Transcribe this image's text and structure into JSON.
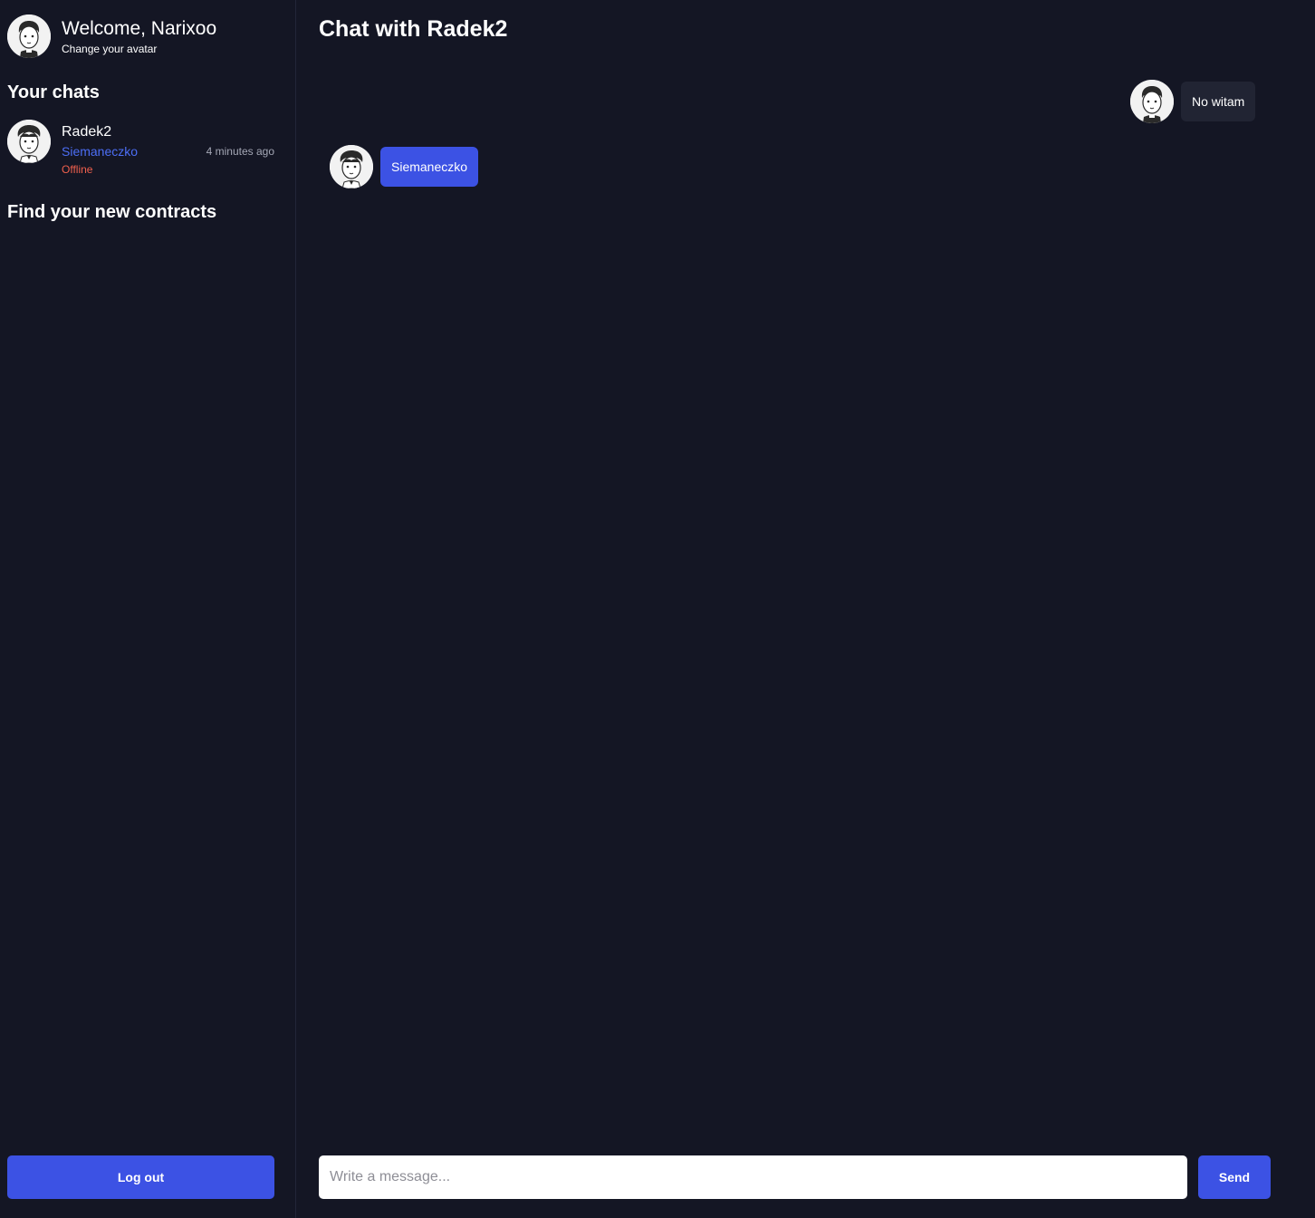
{
  "user": {
    "welcome_text": "Welcome, Narixoo",
    "change_avatar_label": "Change your avatar",
    "avatar_icon": "user-avatar-curly-hair-icon"
  },
  "sidebar": {
    "chats_heading": "Your chats",
    "contracts_heading": "Find your new contracts",
    "chats": [
      {
        "name": "Radek2",
        "last_message": "Siemaneczko",
        "status": "Offline",
        "time": "4 minutes ago",
        "avatar_icon": "user-avatar-icon"
      }
    ],
    "logout_label": "Log out"
  },
  "chat": {
    "title": "Chat with Radek2",
    "messages": [
      {
        "from": "me",
        "text": "No witam"
      },
      {
        "from": "Radek2",
        "text": "Siemaneczko"
      }
    ],
    "input_placeholder": "Write a message...",
    "send_label": "Send"
  },
  "colors": {
    "background": "#141624",
    "accent": "#3c52e4",
    "own_bubble": "#212433",
    "last_message": "#4c6ef5",
    "offline": "#f0604d",
    "muted": "#a4a7b5"
  }
}
